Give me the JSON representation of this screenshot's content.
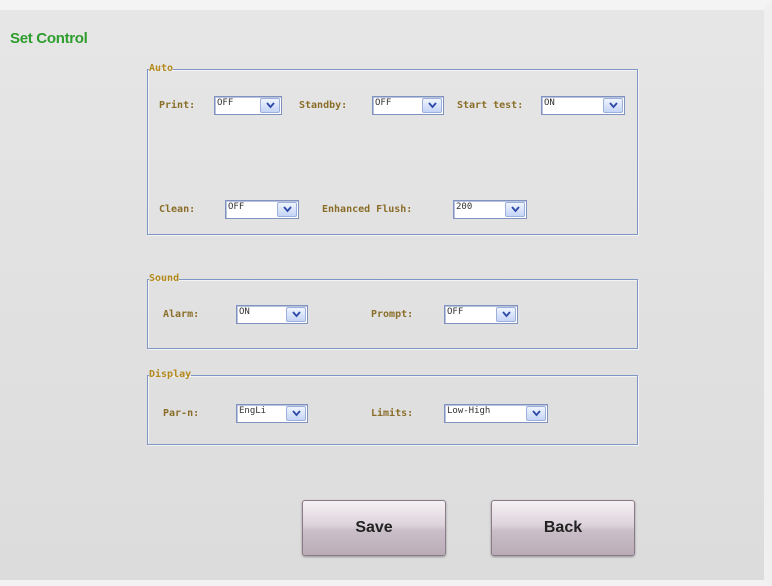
{
  "window": {
    "title": "Set Control"
  },
  "auto": {
    "legend": "Auto",
    "print": {
      "label": "Print:",
      "value": "OFF"
    },
    "standby": {
      "label": "Standby:",
      "value": "OFF"
    },
    "start_test": {
      "label": "Start test:",
      "value": "ON"
    },
    "clean": {
      "label": "Clean:",
      "value": "OFF"
    },
    "enhanced_flush": {
      "label": "Enhanced Flush:",
      "value": "200"
    }
  },
  "sound": {
    "legend": "Sound",
    "alarm": {
      "label": "Alarm:",
      "value": "ON"
    },
    "prompt": {
      "label": "Prompt:",
      "value": "OFF"
    }
  },
  "display": {
    "legend": "Display",
    "par_n": {
      "label": "Par-n:",
      "value": "EngLi"
    },
    "limits": {
      "label": "Limits:",
      "value": "Low-High"
    }
  },
  "buttons": {
    "save": "Save",
    "back": "Back"
  },
  "colors": {
    "title": "#2e9d2e",
    "label": "#8a6d28",
    "legend": "#b48a1c",
    "border": "#7f95c6"
  },
  "icons": {
    "dropdown": "chevron-down-icon"
  }
}
